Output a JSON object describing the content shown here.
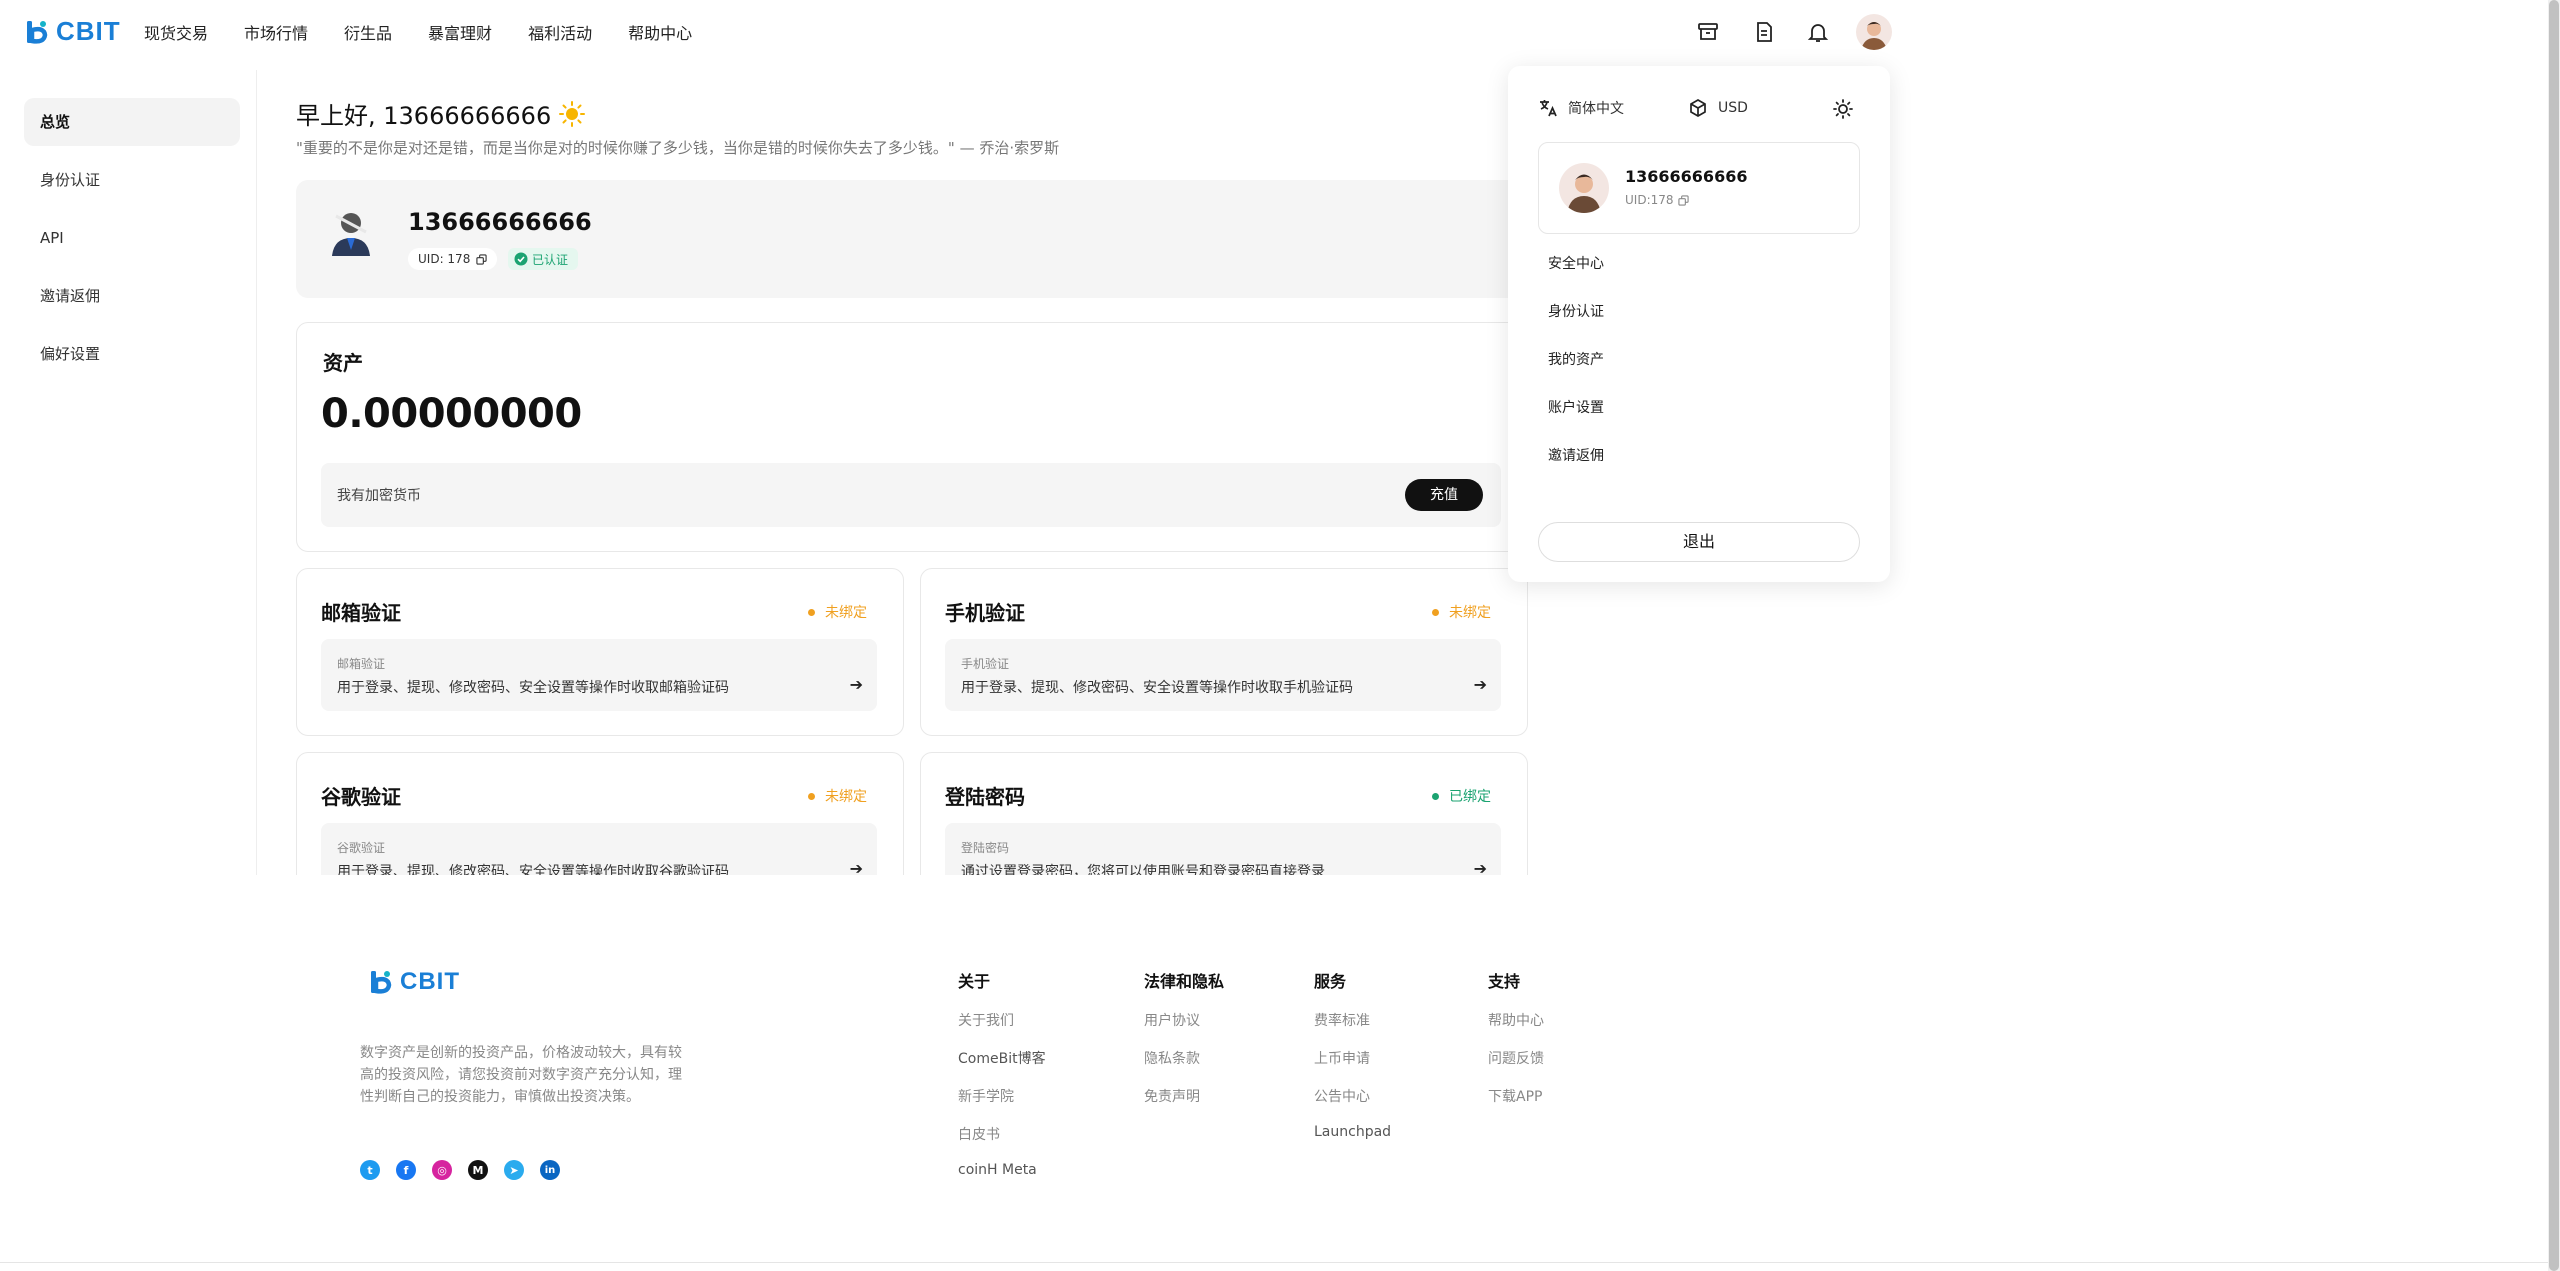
{
  "brand": {
    "name": "CBIT",
    "color": "#1a7fd6"
  },
  "nav": [
    {
      "label": "现货交易"
    },
    {
      "label": "市场行情"
    },
    {
      "label": "衍生品"
    },
    {
      "label": "暴富理财"
    },
    {
      "label": "福利活动"
    },
    {
      "label": "帮助中心"
    }
  ],
  "sidebar": {
    "items": [
      {
        "label": "总览",
        "active": true
      },
      {
        "label": "身份认证"
      },
      {
        "label": "API"
      },
      {
        "label": "邀请返佣"
      },
      {
        "label": "偏好设置"
      }
    ]
  },
  "greeting": {
    "text": "早上好, 13666666666",
    "quote": "\"重要的不是你是对还是错，而是当你是对的时候你赚了多少钱，当你是错的时候你失去了多少钱。\" — 乔治·索罗斯"
  },
  "profile": {
    "name": "13666666666",
    "uid_label": "UID: 178",
    "verified": "已认证"
  },
  "assets": {
    "title": "资产",
    "value": "0.00000000",
    "crypto_label": "我有加密货币",
    "deposit": "充值"
  },
  "security": [
    {
      "title": "邮箱验证",
      "status": "未绑定",
      "state": "unbound",
      "label": "邮箱验证",
      "desc": "用于登录、提现、修改密码、安全设置等操作时收取邮箱验证码"
    },
    {
      "title": "手机验证",
      "status": "未绑定",
      "state": "unbound",
      "label": "手机验证",
      "desc": "用于登录、提现、修改密码、安全设置等操作时收取手机验证码"
    },
    {
      "title": "谷歌验证",
      "status": "未绑定",
      "state": "unbound",
      "label": "谷歌验证",
      "desc": "用于登录、提现、修改密码、安全设置等操作时收取谷歌验证码"
    },
    {
      "title": "登陆密码",
      "status": "已绑定",
      "state": "bound",
      "label": "登陆密码",
      "desc": "通过设置登录密码，您将可以使用账号和登录密码直接登录"
    }
  ],
  "dropdown": {
    "language": "简体中文",
    "currency": "USD",
    "user_name": "13666666666",
    "user_uid": "UID:178",
    "menu": [
      {
        "label": "安全中心"
      },
      {
        "label": "身份认证"
      },
      {
        "label": "我的资产"
      },
      {
        "label": "账户设置"
      },
      {
        "label": "邀请返佣"
      }
    ],
    "logout": "退出"
  },
  "footer": {
    "desc": "数字资产是创新的投资产品，价格波动较大，具有较高的投资风险，请您投资前对数字资产充分认知，理性判断自己的投资能力，审慎做出投资决策。",
    "columns": [
      {
        "title": "关于",
        "links": [
          "关于我们",
          "ComeBit博客",
          "新手学院",
          "白皮书",
          "coinH Meta"
        ]
      },
      {
        "title": "法律和隐私",
        "links": [
          "用户协议",
          "隐私条款",
          "免责声明"
        ]
      },
      {
        "title": "服务",
        "links": [
          "费率标准",
          "上币申请",
          "公告中心",
          "Launchpad"
        ]
      },
      {
        "title": "支持",
        "links": [
          "帮助中心",
          "问题反馈",
          "下载APP"
        ]
      }
    ],
    "social": [
      {
        "name": "twitter-icon",
        "glyph": "t",
        "color": "#1d9bf0"
      },
      {
        "name": "facebook-icon",
        "glyph": "f",
        "color": "#1877f2"
      },
      {
        "name": "instagram-icon",
        "glyph": "◎",
        "color": "#d6249f"
      },
      {
        "name": "medium-icon",
        "glyph": "M",
        "color": "#111111"
      },
      {
        "name": "telegram-icon",
        "glyph": "➤",
        "color": "#2aabee"
      },
      {
        "name": "linkedin-icon",
        "glyph": "in",
        "color": "#0a66c2"
      }
    ]
  },
  "colors": {
    "unbound": "#f0a020",
    "bound": "#1ba371",
    "verified_bg": "#e5f7ef"
  }
}
